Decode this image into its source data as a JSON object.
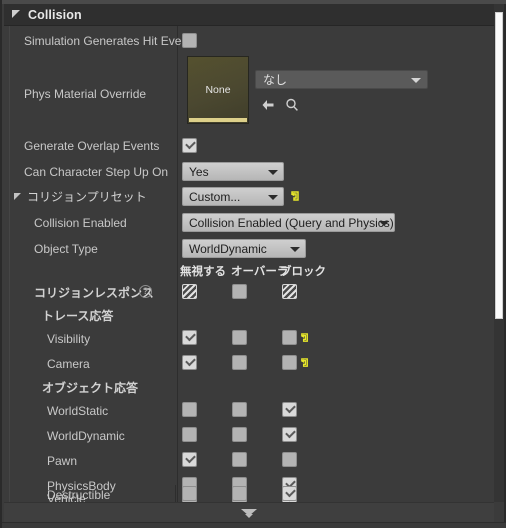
{
  "window": {
    "panel_title": "Collision",
    "collapse_footer_icon": "chevron-double-down-icon"
  },
  "colors": {
    "accent_reset": "#e8e82a",
    "panel_bg": "#3b3b3b",
    "header_bg": "#2f2f2f",
    "combo_bg": "#c4c4c4",
    "checkbox_bg": "#b3b3b3",
    "thumbnail_olive": "#4d4a33",
    "thumbnail_strip": "#ddd08a",
    "scrollbar_thumb": "#fbfbfb"
  },
  "response_columns": [
    {
      "label": "無視する",
      "name": "ignore"
    },
    {
      "label": "オーバーラ",
      "name": "overlap"
    },
    {
      "label": "ブロック",
      "name": "block"
    }
  ],
  "properties": [
    {
      "name": "simulation-generates-hit-events",
      "label": "Simulation Generates Hit Event",
      "type": "checkbox",
      "value": "unchecked"
    },
    {
      "name": "phys-material-override",
      "label": "Phys Material Override",
      "type": "asset",
      "thumbnail_label": "None",
      "value": "なし",
      "icons": [
        "back-arrow-icon",
        "browse-search-icon"
      ]
    },
    {
      "name": "generate-overlap-events",
      "label": "Generate Overlap Events",
      "type": "checkbox",
      "value": "checked"
    },
    {
      "name": "can-character-step-up-on",
      "label": "Can Character Step Up On",
      "type": "combo",
      "value": "Yes"
    },
    {
      "name": "collision-preset",
      "label": "コリジョンプリセット",
      "type": "combo",
      "value": "Custom...",
      "expander": "expanded",
      "reset_icon": "reset-to-default-icon"
    },
    {
      "name": "collision-enabled",
      "label": "Collision Enabled",
      "type": "combo",
      "value": "Collision Enabled (Query and Physics)"
    },
    {
      "name": "object-type",
      "label": "Object Type",
      "type": "combo",
      "value": "WorldDynamic"
    }
  ],
  "collision_responses": {
    "label": "コリジョンレスポンス",
    "help_icon": "help-question-icon",
    "master_states": [
      "mixed",
      "unchecked",
      "mixed"
    ],
    "groups": [
      {
        "name": "trace-responses",
        "label": "トレース応答",
        "rows": [
          {
            "name": "visibility",
            "label": "Visibility",
            "states": [
              "checked",
              "unchecked",
              "unchecked"
            ],
            "reset_icon": "reset-to-default-icon"
          },
          {
            "name": "camera",
            "label": "Camera",
            "states": [
              "checked",
              "unchecked",
              "unchecked"
            ],
            "reset_icon": "reset-to-default-icon"
          }
        ]
      },
      {
        "name": "object-responses",
        "label": "オブジェクト応答",
        "rows": [
          {
            "name": "worldstatic",
            "label": "WorldStatic",
            "states": [
              "unchecked",
              "unchecked",
              "checked"
            ],
            "reset_icon": null
          },
          {
            "name": "worlddynamic",
            "label": "WorldDynamic",
            "states": [
              "unchecked",
              "unchecked",
              "checked"
            ],
            "reset_icon": null
          },
          {
            "name": "pawn",
            "label": "Pawn",
            "states": [
              "checked",
              "unchecked",
              "unchecked"
            ],
            "reset_icon": null
          },
          {
            "name": "physicsbody",
            "label": "PhysicsBody",
            "states": [
              "unchecked",
              "unchecked",
              "checked"
            ],
            "reset_icon": null
          },
          {
            "name": "vehicle",
            "label": "Vehicle",
            "states": [
              "unchecked",
              "unchecked",
              "checked"
            ],
            "reset_icon": null
          },
          {
            "name": "destructible",
            "label": "Destructible",
            "states": [
              "unchecked",
              "unchecked",
              "checked"
            ],
            "reset_icon": null
          }
        ]
      }
    ]
  }
}
